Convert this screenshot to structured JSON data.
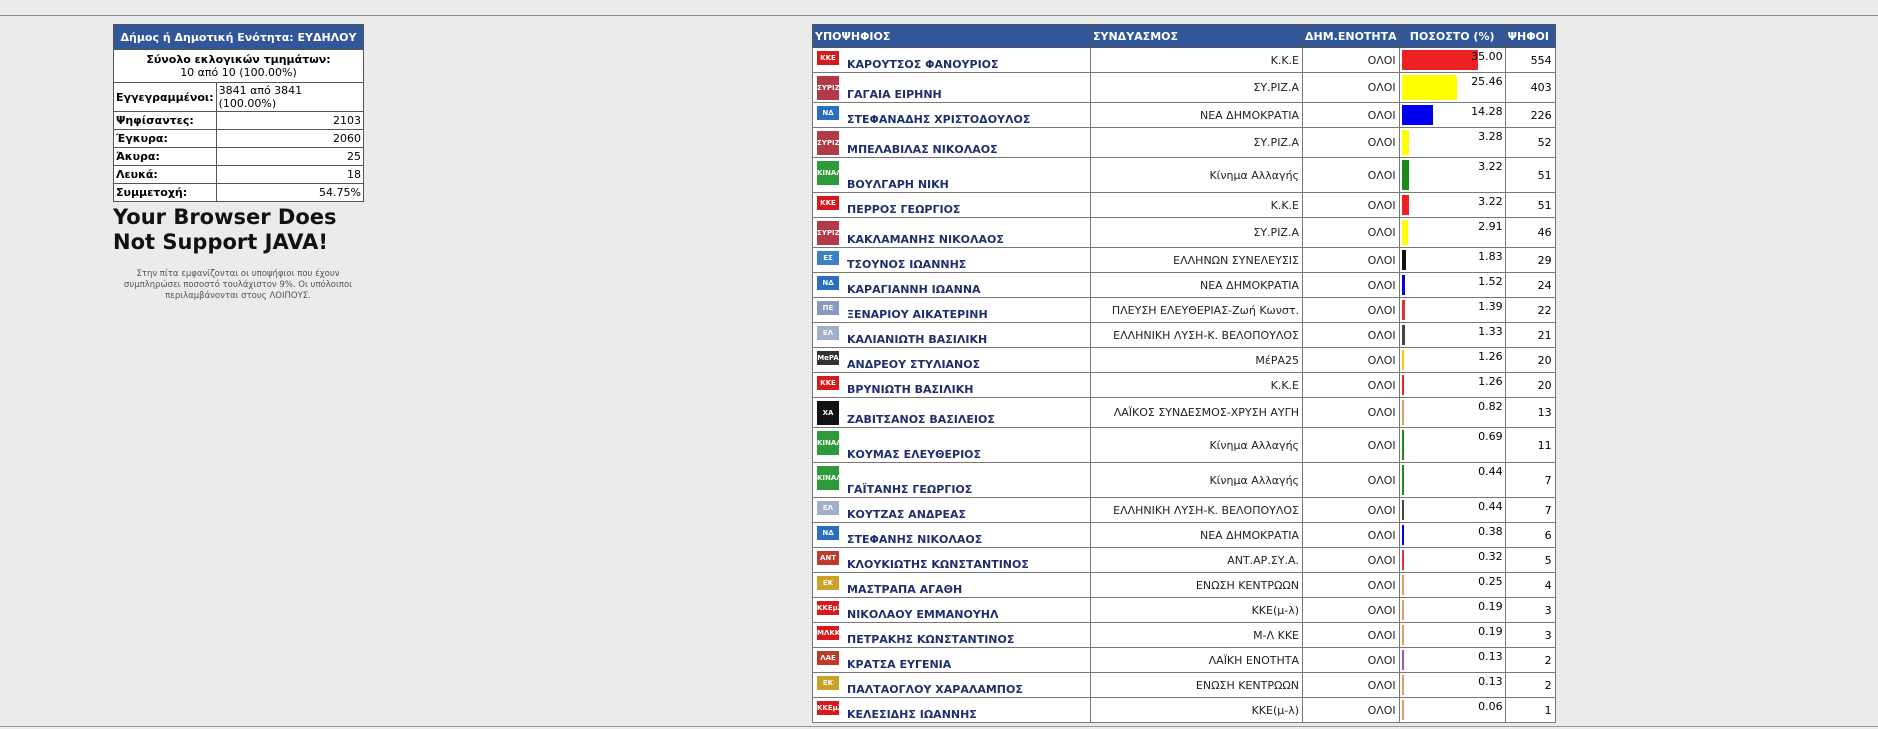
{
  "summary": {
    "title": "Δήμος ή Δημοτική Ενότητα: ΕΥΔΗΛΟΥ",
    "total_label": "Σύνολο εκλογικών τμημάτων:",
    "total_value": "10 από 10 (100.00%)",
    "rows": [
      {
        "label": "Εγγεγραμμένοι:",
        "value": "3841 από 3841 (100.00%)"
      },
      {
        "label": "Ψηφίσαντες:",
        "value": "2103"
      },
      {
        "label": "Έγκυρα:",
        "value": "2060"
      },
      {
        "label": "Άκυρα:",
        "value": "25"
      },
      {
        "label": "Λευκά:",
        "value": "18"
      },
      {
        "label": "Συμμετοχή:",
        "value": "54.75%"
      }
    ]
  },
  "java_message": "Your Browser Does Not Support JAVA!",
  "note": "Στην πίτα εμφανίζονται οι υποψήφιοι που έχουν συμπληρώσει ποσοστό τουλάχιστον 9%. Οι υπόλοιποι περιλαμβάνονται στους ΛΟΙΠΟΥΣ.",
  "results": {
    "headers": {
      "candidate": "ΥΠΟΨΗΦΙΟΣ",
      "party": "ΣΥΝΔΥΑΣΜΟΣ",
      "unit": "ΔΗΜ.ΕΝΟΤΗΤΑ",
      "percent": "ΠΟΣΟΣΤΟ (%)",
      "votes": "ΨΗΦΟΙ"
    },
    "rows": [
      {
        "name": "ΚΑΡΟΥΤΣΟΣ ΦΑΝΟΥΡΙΟΣ",
        "party": "Κ.Κ.Ε",
        "unit": "ΟΛΟΙ",
        "percent": "35.00",
        "votes": "554",
        "color": "#ee2222",
        "logo": "ΚΚΕ",
        "logo_color": "#d7191c"
      },
      {
        "name": "ΓΑΓΑΙΑ ΕΙΡΗΝΗ",
        "party": "ΣΥ.ΡΙΖ.Α",
        "unit": "ΟΛΟΙ",
        "percent": "25.46",
        "votes": "403",
        "color": "#ffff00",
        "logo": "ΣΥΡΙΖΑ",
        "logo_color": "#b23a48"
      },
      {
        "name": "ΣΤΕΦΑΝΑΔΗΣ ΧΡΙΣΤΟΔΟΥΛΟΣ",
        "party": "ΝΕΑ ΔΗΜΟΚΡΑΤΙΑ",
        "unit": "ΟΛΟΙ",
        "percent": "14.28",
        "votes": "226",
        "color": "#0000ee",
        "logo": "ΝΔ",
        "logo_color": "#2a6fc0"
      },
      {
        "name": "ΜΠΕΛΑΒΙΛΑΣ ΝΙΚΟΛΑΟΣ",
        "party": "ΣΥ.ΡΙΖ.Α",
        "unit": "ΟΛΟΙ",
        "percent": "3.28",
        "votes": "52",
        "color": "#ffff00",
        "logo": "ΣΥΡΙΖΑ",
        "logo_color": "#b23a48"
      },
      {
        "name": "ΒΟΥΛΓΑΡΗ ΝΙΚΗ",
        "party": "Κίνημα Αλλαγής",
        "unit": "ΟΛΟΙ",
        "percent": "3.22",
        "votes": "51",
        "color": "#1a8a1a",
        "logo": "ΚΙΝΑΛ",
        "logo_color": "#2e9b3a"
      },
      {
        "name": "ΠΕΡΡΟΣ ΓΕΩΡΓΙΟΣ",
        "party": "Κ.Κ.Ε",
        "unit": "ΟΛΟΙ",
        "percent": "3.22",
        "votes": "51",
        "color": "#ee2222",
        "logo": "ΚΚΕ",
        "logo_color": "#d7191c"
      },
      {
        "name": "ΚΑΚΛΑΜΑΝΗΣ ΝΙΚΟΛΑΟΣ",
        "party": "ΣΥ.ΡΙΖ.Α",
        "unit": "ΟΛΟΙ",
        "percent": "2.91",
        "votes": "46",
        "color": "#ffff00",
        "logo": "ΣΥΡΙΖΑ",
        "logo_color": "#b23a48"
      },
      {
        "name": "ΤΣΟΥΝΟΣ ΙΩΑΝΝΗΣ",
        "party": "ΕΛΛΗΝΩΝ ΣΥΝΕΛΕΥΣΙΣ",
        "unit": "ΟΛΟΙ",
        "percent": "1.83",
        "votes": "29",
        "color": "#111111",
        "logo": "ΕΣ",
        "logo_color": "#3b82c4"
      },
      {
        "name": "ΚΑΡΑΓΙΑΝΝΗ ΙΩΑΝΝΑ",
        "party": "ΝΕΑ ΔΗΜΟΚΡΑΤΙΑ",
        "unit": "ΟΛΟΙ",
        "percent": "1.52",
        "votes": "24",
        "color": "#0000ee",
        "logo": "ΝΔ",
        "logo_color": "#2a6fc0"
      },
      {
        "name": "ΞΕΝΑΡΙΟΥ ΑΙΚΑΤΕΡΙΝΗ",
        "party": "ΠΛΕΥΣΗ ΕΛΕΥΘΕΡΙΑΣ-Ζωή Κωνστ.",
        "unit": "ΟΛΟΙ",
        "percent": "1.39",
        "votes": "22",
        "color": "#dd3333",
        "logo": "ΠΕ",
        "logo_color": "#8a9bc0"
      },
      {
        "name": "ΚΑΛΙΑΝΙΩΤΗ ΒΑΣΙΛΙΚΗ",
        "party": "ΕΛΛΗΝΙΚΗ ΛΥΣΗ-Κ. ΒΕΛΟΠΟΥΛΟΣ",
        "unit": "ΟΛΟΙ",
        "percent": "1.33",
        "votes": "21",
        "color": "#444444",
        "logo": "ΕΛ",
        "logo_color": "#9fb0c8"
      },
      {
        "name": "ΑΝΔΡΕΟΥ ΣΤΥΛΙΑΝΟΣ",
        "party": "ΜέΡΑ25",
        "unit": "ΟΛΟΙ",
        "percent": "1.26",
        "votes": "20",
        "color": "#ffcc00",
        "logo": "MePA",
        "logo_color": "#333333"
      },
      {
        "name": "ΒΡΥΝΙΩΤΗ ΒΑΣΙΛΙΚΗ",
        "party": "Κ.Κ.Ε",
        "unit": "ΟΛΟΙ",
        "percent": "1.26",
        "votes": "20",
        "color": "#ee2222",
        "logo": "ΚΚΕ",
        "logo_color": "#d7191c"
      },
      {
        "name": "ΖΑΒΙΤΣΑΝΟΣ ΒΑΣΙΛΕΙΟΣ",
        "party": "ΛΑΪΚΟΣ ΣΥΝΔΕΣΜΟΣ-ΧΡΥΣΗ ΑΥΓΗ",
        "unit": "ΟΛΟΙ",
        "percent": "0.82",
        "votes": "13",
        "color": "#e0a060",
        "logo": "ΧΑ",
        "logo_color": "#111111"
      },
      {
        "name": "ΚΟΥΜΑΣ ΕΛΕΥΘΕΡΙΟΣ",
        "party": "Κίνημα Αλλαγής",
        "unit": "ΟΛΟΙ",
        "percent": "0.69",
        "votes": "11",
        "color": "#1a8a1a",
        "logo": "ΚΙΝΑΛ",
        "logo_color": "#2e9b3a"
      },
      {
        "name": "ΓΑΪΤΑΝΗΣ ΓΕΩΡΓΙΟΣ",
        "party": "Κίνημα Αλλαγής",
        "unit": "ΟΛΟΙ",
        "percent": "0.44",
        "votes": "7",
        "color": "#1a8a1a",
        "logo": "ΚΙΝΑΛ",
        "logo_color": "#2e9b3a"
      },
      {
        "name": "ΚΟΥΤΖΑΣ ΑΝΔΡΕΑΣ",
        "party": "ΕΛΛΗΝΙΚΗ ΛΥΣΗ-Κ. ΒΕΛΟΠΟΥΛΟΣ",
        "unit": "ΟΛΟΙ",
        "percent": "0.44",
        "votes": "7",
        "color": "#444444",
        "logo": "ΕΛ",
        "logo_color": "#9fb0c8"
      },
      {
        "name": "ΣΤΕΦΑΝΗΣ ΝΙΚΟΛΑΟΣ",
        "party": "ΝΕΑ ΔΗΜΟΚΡΑΤΙΑ",
        "unit": "ΟΛΟΙ",
        "percent": "0.38",
        "votes": "6",
        "color": "#0000ee",
        "logo": "ΝΔ",
        "logo_color": "#2a6fc0"
      },
      {
        "name": "ΚΛΟΥΚΙΩΤΗΣ ΚΩΝΣΤΑΝΤΙΝΟΣ",
        "party": "ΑΝΤ.ΑΡ.ΣΥ.Α.",
        "unit": "ΟΛΟΙ",
        "percent": "0.32",
        "votes": "5",
        "color": "#dd3333",
        "logo": "ΑΝΤ",
        "logo_color": "#c0392b"
      },
      {
        "name": "ΜΑΣΤΡΑΠΑ ΑΓΑΘΗ",
        "party": "ΕΝΩΣΗ ΚΕΝΤΡΩΩΝ",
        "unit": "ΟΛΟΙ",
        "percent": "0.25",
        "votes": "4",
        "color": "#e0a060",
        "logo": "ΕΚ",
        "logo_color": "#c9a227"
      },
      {
        "name": "ΝΙΚΟΛΑΟΥ ΕΜΜΑΝΟΥΗΛ",
        "party": "ΚΚΕ(μ-λ)",
        "unit": "ΟΛΟΙ",
        "percent": "0.19",
        "votes": "3",
        "color": "#e0a060",
        "logo": "ΚΚΕμλ",
        "logo_color": "#d7191c"
      },
      {
        "name": "ΠΕΤΡΑΚΗΣ ΚΩΝΣΤΑΝΤΙΝΟΣ",
        "party": "Μ-Λ ΚΚΕ",
        "unit": "ΟΛΟΙ",
        "percent": "0.19",
        "votes": "3",
        "color": "#e0a060",
        "logo": "ΜΛΚΚΕ",
        "logo_color": "#d7191c"
      },
      {
        "name": "ΚΡΑΤΣΑ ΕΥΓΕΝΙΑ",
        "party": "ΛΑΪΚΗ ΕΝΟΤΗΤΑ",
        "unit": "ΟΛΟΙ",
        "percent": "0.13",
        "votes": "2",
        "color": "#9b59b6",
        "logo": "ΛΑΕ",
        "logo_color": "#c0392b"
      },
      {
        "name": "ΠΑΛΤΑΟΓΛΟΥ ΧΑΡΑΛΑΜΠΟΣ",
        "party": "ΕΝΩΣΗ ΚΕΝΤΡΩΩΝ",
        "unit": "ΟΛΟΙ",
        "percent": "0.13",
        "votes": "2",
        "color": "#e0a060",
        "logo": "ΕΚ",
        "logo_color": "#c9a227"
      },
      {
        "name": "ΚΕΛΕΣΙΔΗΣ ΙΩΑΝΝΗΣ",
        "party": "ΚΚΕ(μ-λ)",
        "unit": "ΟΛΟΙ",
        "percent": "0.06",
        "votes": "1",
        "color": "#e0a060",
        "logo": "ΚΚΕμλ",
        "logo_color": "#d7191c"
      }
    ]
  }
}
